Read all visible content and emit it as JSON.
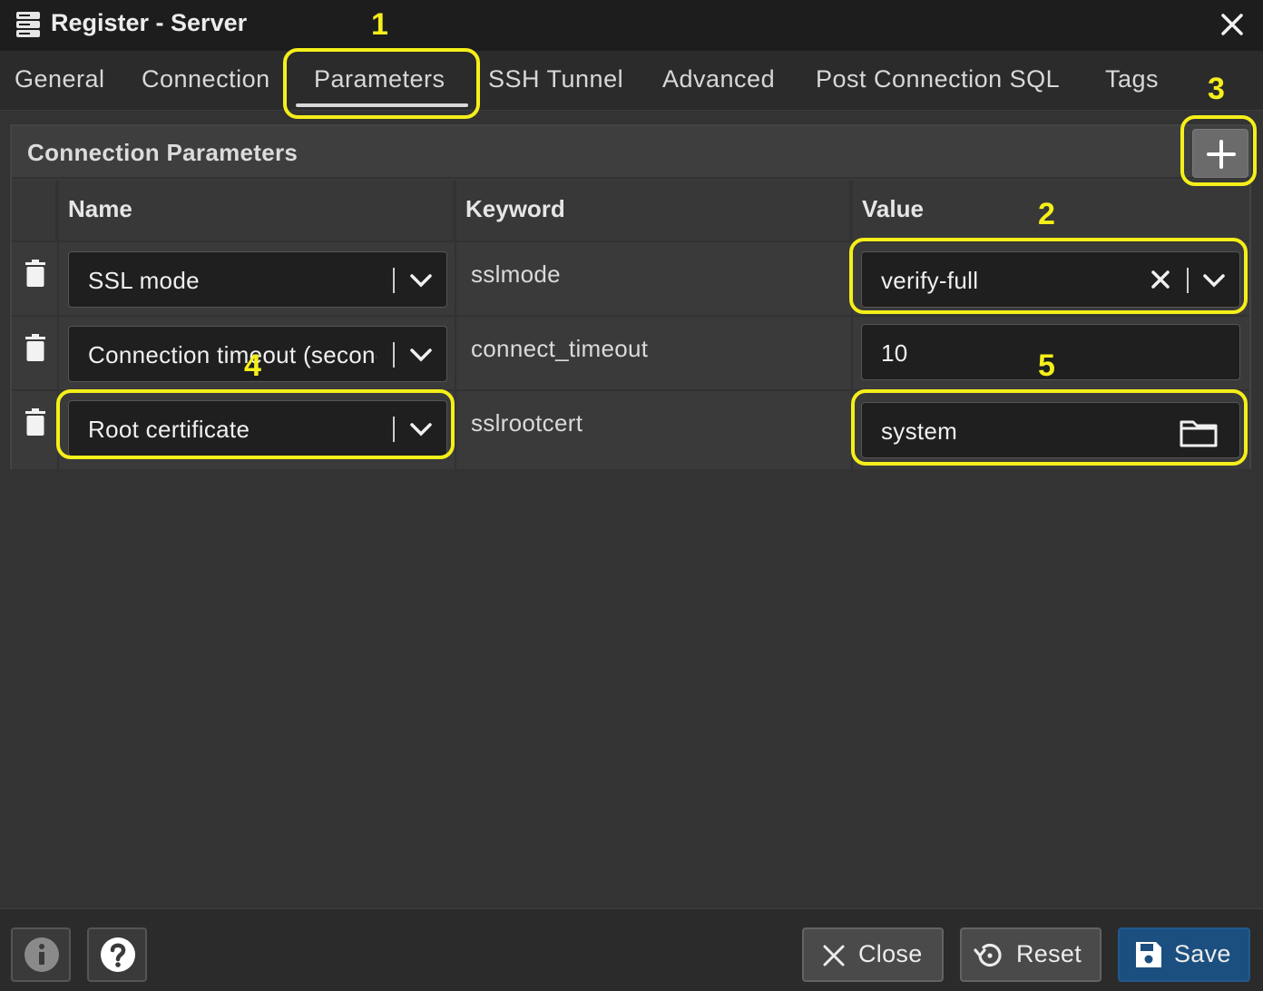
{
  "window": {
    "title": "Register - Server",
    "close_icon": "close-icon"
  },
  "tabs": [
    {
      "label": "General"
    },
    {
      "label": "Connection"
    },
    {
      "label": "Parameters",
      "active": true
    },
    {
      "label": "SSH Tunnel"
    },
    {
      "label": "Advanced"
    },
    {
      "label": "Post Connection SQL"
    },
    {
      "label": "Tags"
    }
  ],
  "panel": {
    "title": "Connection Parameters",
    "add_icon": "plus-icon",
    "columns": [
      "Name",
      "Keyword",
      "Value"
    ],
    "rows": [
      {
        "name": "SSL mode",
        "keyword": "sslmode",
        "value": "verify-full",
        "value_type": "select-clearable"
      },
      {
        "name": "Connection timeout (seconds)",
        "keyword": "connect_timeout",
        "value": "10",
        "value_type": "text"
      },
      {
        "name": "Root certificate",
        "keyword": "sslrootcert",
        "value": "system",
        "value_type": "file"
      }
    ]
  },
  "annotations": {
    "color": "#f5ef1a",
    "labels": [
      "1",
      "2",
      "3",
      "4",
      "5"
    ]
  },
  "footer": {
    "close_label": "Close",
    "reset_label": "Reset",
    "save_label": "Save",
    "accent": "#1b4f7f"
  }
}
